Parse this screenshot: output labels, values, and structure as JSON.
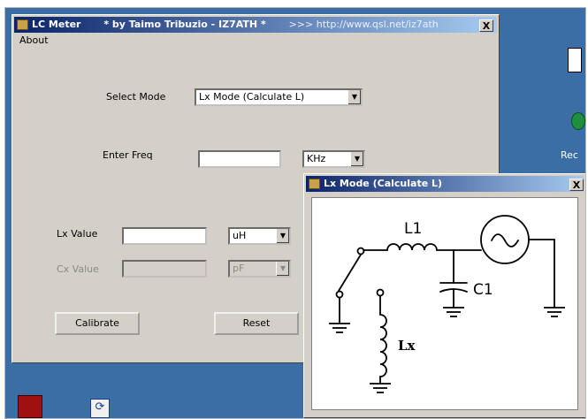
{
  "main_window": {
    "title": "LC Meter",
    "title_author": "* by Taimo Tribuzio - IZ7ATH *",
    "title_link": ">>> http://www.qsl.net/iz7ath",
    "close": "X",
    "menu": [
      "About"
    ],
    "select_mode_label": "Select Mode",
    "mode_value": "Lx Mode (Calculate L)",
    "enter_freq_label": "Enter Freq",
    "freq_value": "",
    "freq_unit": "KHz",
    "lx_label": "Lx Value",
    "lx_value": "",
    "lx_unit": "uH",
    "cx_label": "Cx Value",
    "cx_value": "",
    "cx_unit": "pF",
    "calibrate_button": "Calibrate",
    "reset_button": "Reset"
  },
  "diagram_window": {
    "title": "Lx Mode (Calculate L)",
    "close": "X",
    "labels": {
      "l1": "L1",
      "c1": "C1",
      "lx": "Lx"
    }
  },
  "desktop": {
    "icon_label": "Rec"
  }
}
